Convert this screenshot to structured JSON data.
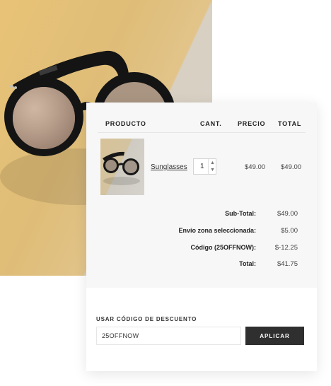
{
  "table": {
    "headers": {
      "product": "PRODUCTO",
      "qty": "CANT.",
      "price": "PRECIO",
      "total": "TOTAL"
    },
    "rows": [
      {
        "name": "Sunglasses",
        "qty": "1",
        "price": "$49.00",
        "total": "$49.00"
      }
    ]
  },
  "summary": {
    "subtotal_label": "Sub-Total:",
    "subtotal": "$49.00",
    "shipping_label": "Envío zona seleccionada:",
    "shipping": "$5.00",
    "code_label": "Código (25OFFNOW):",
    "code": "$-12.25",
    "total_label": "Total:",
    "total": "$41.75"
  },
  "coupon": {
    "label": "USAR CÓDIGO DE DESCUENTO",
    "value": "25OFFNOW",
    "button": "APLICAR"
  },
  "colors": {
    "button": "#2f2f2f",
    "hero_yellow": "#e8c377",
    "panel": "#f7f7f7"
  },
  "icons": {
    "qty_up": "chevron-up-icon",
    "qty_down": "chevron-down-icon"
  }
}
